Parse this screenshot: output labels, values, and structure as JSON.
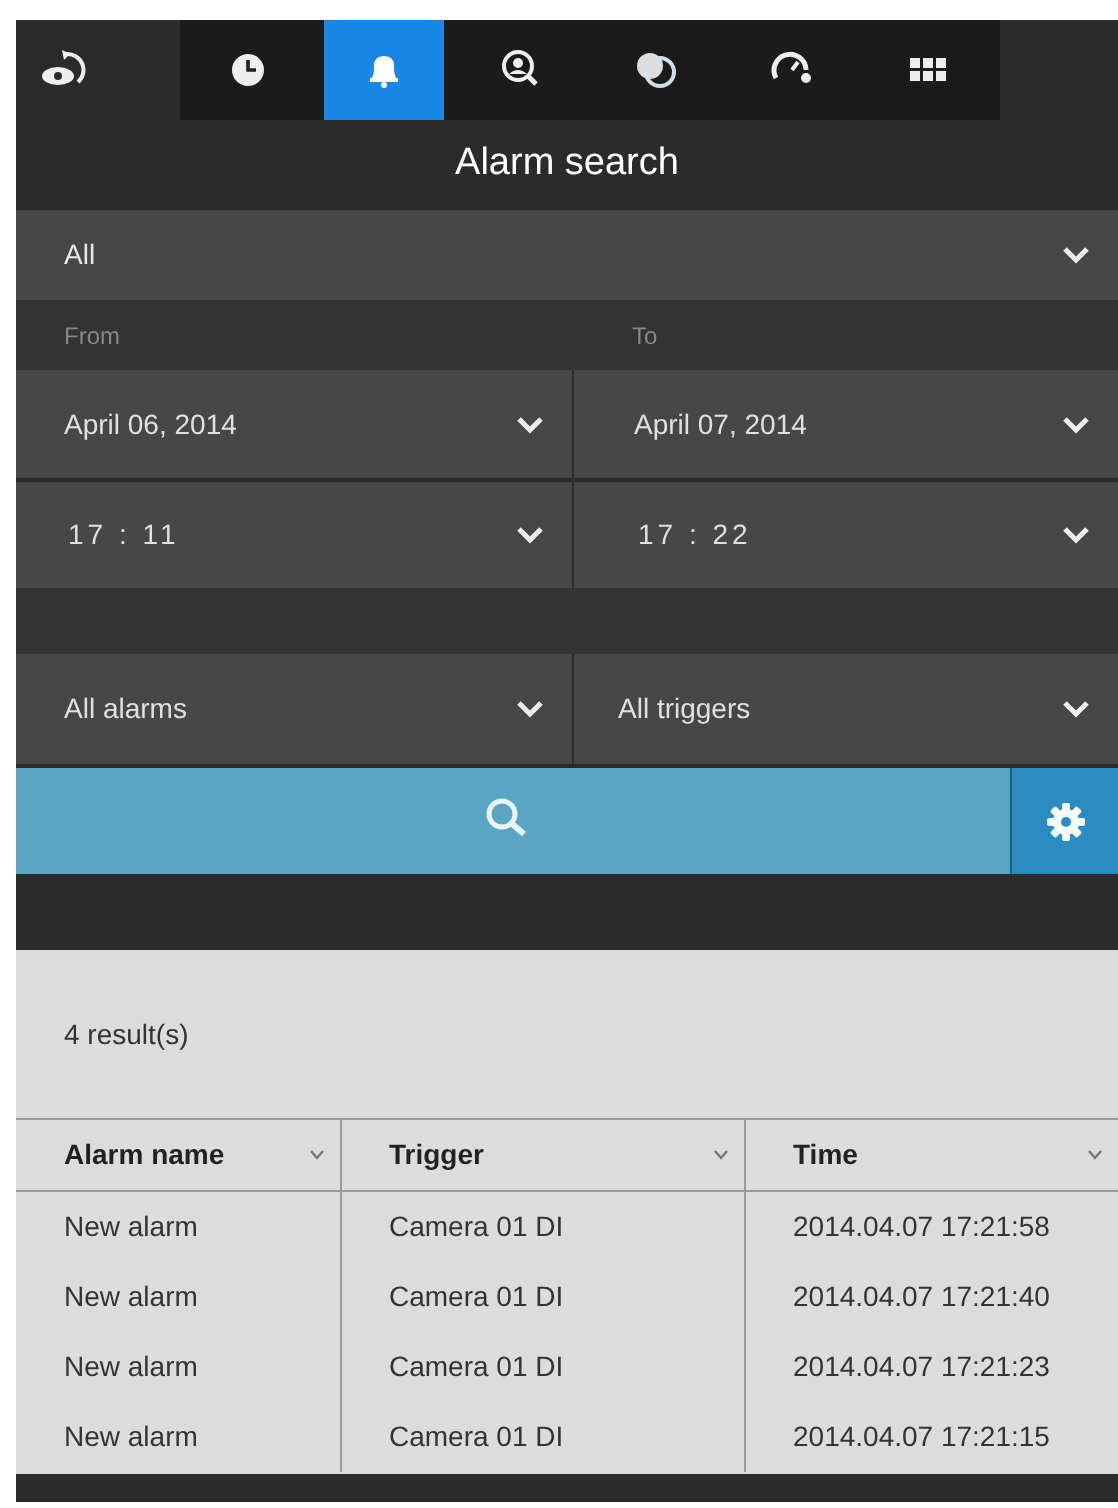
{
  "toolbar": {
    "tabs": [
      {
        "kind": "clock",
        "selected": false
      },
      {
        "kind": "bell",
        "selected": true
      },
      {
        "kind": "person-search",
        "selected": false
      },
      {
        "kind": "circles",
        "selected": false
      },
      {
        "kind": "gauge",
        "selected": false
      },
      {
        "kind": "grid",
        "selected": false
      }
    ]
  },
  "title": "Alarm search",
  "filter": {
    "value": "All"
  },
  "from_label": "From",
  "to_label": "To",
  "from_date": "April 06, 2014",
  "to_date": "April 07, 2014",
  "from_time": "17 : 11",
  "to_time": "17 : 22",
  "alarm_filter": "All alarms",
  "trigger_filter": "All triggers",
  "result_count": "4 result(s)",
  "table": {
    "columns": [
      "Alarm name",
      "Trigger",
      "Time"
    ],
    "rows": [
      [
        "New alarm",
        "Camera 01 DI",
        "2014.04.07 17:21:58"
      ],
      [
        "New alarm",
        "Camera 01 DI",
        "2014.04.07 17:21:40"
      ],
      [
        "New alarm",
        "Camera 01 DI",
        "2014.04.07 17:21:23"
      ],
      [
        "New alarm",
        "Camera 01 DI",
        "2014.04.07 17:21:15"
      ]
    ]
  }
}
